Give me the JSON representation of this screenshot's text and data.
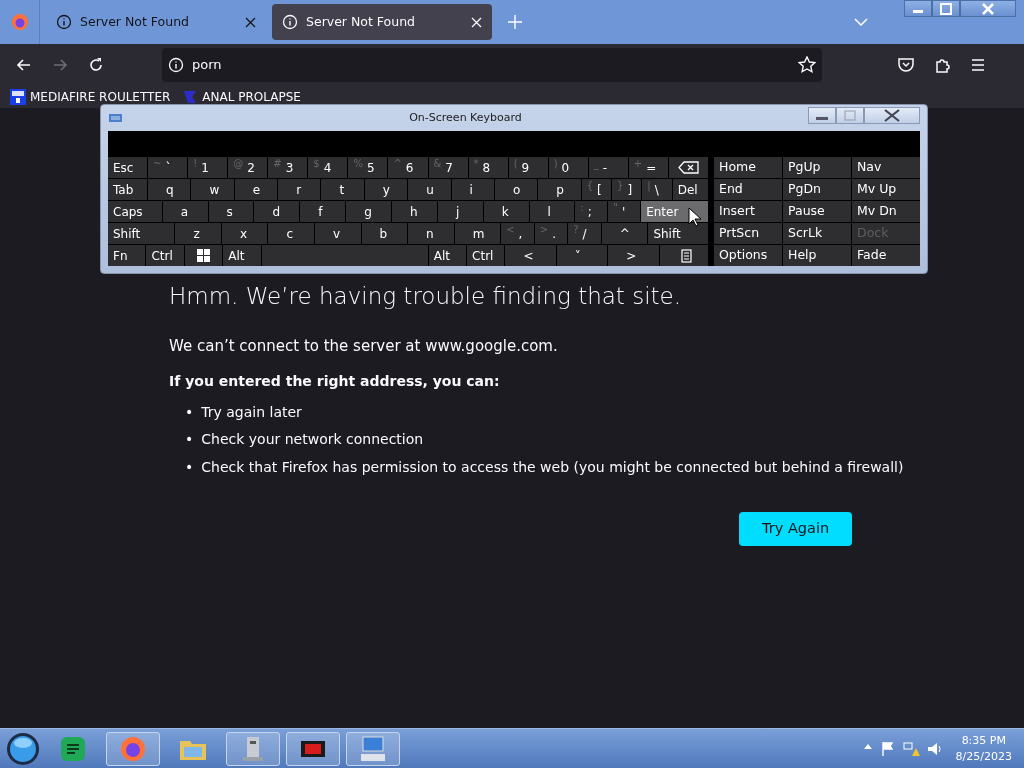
{
  "tabs": [
    {
      "title": "Server Not Found",
      "selected": false
    },
    {
      "title": "Server Not Found",
      "selected": true
    }
  ],
  "url": "porn",
  "bookmarks": [
    {
      "label": "MEDIAFIRE ROULETTER",
      "kind": "mf"
    },
    {
      "label": "ANAL PROLAPSE",
      "kind": "flag"
    }
  ],
  "keyboard": {
    "title": "On-Screen Keyboard",
    "main_rows": [
      [
        {
          "label": "Esc"
        },
        {
          "label": "`",
          "shift": "~"
        },
        {
          "label": "1",
          "shift": "!"
        },
        {
          "label": "2",
          "shift": "@"
        },
        {
          "label": "3",
          "shift": "#"
        },
        {
          "label": "4",
          "shift": "$"
        },
        {
          "label": "5",
          "shift": "%"
        },
        {
          "label": "6",
          "shift": "^"
        },
        {
          "label": "7",
          "shift": "&"
        },
        {
          "label": "8",
          "shift": "*"
        },
        {
          "label": "9",
          "shift": "("
        },
        {
          "label": "0",
          "shift": ")"
        },
        {
          "label": "-",
          "shift": "_"
        },
        {
          "label": "=",
          "shift": "+"
        },
        {
          "kind": "backspace"
        }
      ],
      [
        {
          "label": "Tab"
        },
        {
          "label": "q"
        },
        {
          "label": "w"
        },
        {
          "label": "e"
        },
        {
          "label": "r"
        },
        {
          "label": "t"
        },
        {
          "label": "y"
        },
        {
          "label": "u"
        },
        {
          "label": "i"
        },
        {
          "label": "o"
        },
        {
          "label": "p"
        },
        {
          "label": "[",
          "shift": "{"
        },
        {
          "label": "]",
          "shift": "}"
        },
        {
          "label": "\\",
          "shift": "|"
        },
        {
          "label": "Del"
        }
      ],
      [
        {
          "label": "Caps"
        },
        {
          "label": "a"
        },
        {
          "label": "s"
        },
        {
          "label": "d"
        },
        {
          "label": "f"
        },
        {
          "label": "g"
        },
        {
          "label": "h"
        },
        {
          "label": "j"
        },
        {
          "label": "k"
        },
        {
          "label": "l"
        },
        {
          "label": ";",
          "shift": ":"
        },
        {
          "label": "'",
          "shift": "\""
        },
        {
          "label": "Enter",
          "hovered": true
        }
      ],
      [
        {
          "label": "Shift"
        },
        {
          "label": "z"
        },
        {
          "label": "x"
        },
        {
          "label": "c"
        },
        {
          "label": "v"
        },
        {
          "label": "b"
        },
        {
          "label": "n"
        },
        {
          "label": "m"
        },
        {
          "label": ",",
          "shift": "<"
        },
        {
          "label": ".",
          "shift": ">"
        },
        {
          "label": "/",
          "shift": "?"
        },
        {
          "label": "^"
        },
        {
          "label": "Shift"
        }
      ],
      [
        {
          "label": "Fn"
        },
        {
          "label": "Ctrl"
        },
        {
          "kind": "windows"
        },
        {
          "label": "Alt"
        },
        {
          "kind": "space"
        },
        {
          "label": "Alt"
        },
        {
          "label": "Ctrl"
        },
        {
          "label": "<"
        },
        {
          "label": "˅"
        },
        {
          "label": ">"
        },
        {
          "kind": "menu"
        }
      ]
    ],
    "side_rows": [
      [
        {
          "label": "Home",
          "disabled": false
        },
        {
          "label": "PgUp",
          "disabled": false
        },
        {
          "label": "Nav",
          "disabled": false
        }
      ],
      [
        {
          "label": "End",
          "disabled": false
        },
        {
          "label": "PgDn",
          "disabled": false
        },
        {
          "label": "Mv Up",
          "disabled": false
        }
      ],
      [
        {
          "label": "Insert",
          "disabled": false
        },
        {
          "label": "Pause",
          "disabled": false
        },
        {
          "label": "Mv Dn",
          "disabled": false
        }
      ],
      [
        {
          "label": "PrtScn",
          "disabled": false
        },
        {
          "label": "ScrLk",
          "disabled": false
        },
        {
          "label": "Dock",
          "disabled": true
        }
      ],
      [
        {
          "label": "Options",
          "disabled": false
        },
        {
          "label": "Help",
          "disabled": false
        },
        {
          "label": "Fade",
          "disabled": false
        }
      ]
    ]
  },
  "error": {
    "title": "Hmm. We’re having trouble finding that site.",
    "message": "We can’t connect to the server at www.google.com.",
    "subtitle": "If you entered the right address, you can:",
    "tips": [
      {
        "bullet": "•",
        "text": "Try again later"
      },
      {
        "bullet": "•",
        "text": "Check your network connection"
      },
      {
        "bullet": "•",
        "text": "Check that Firefox has permission to access the web (you might be connected but behind a firewall)"
      }
    ],
    "button": "Try Again"
  },
  "clock": {
    "time": "8:35 PM",
    "date": "8/25/2023"
  }
}
